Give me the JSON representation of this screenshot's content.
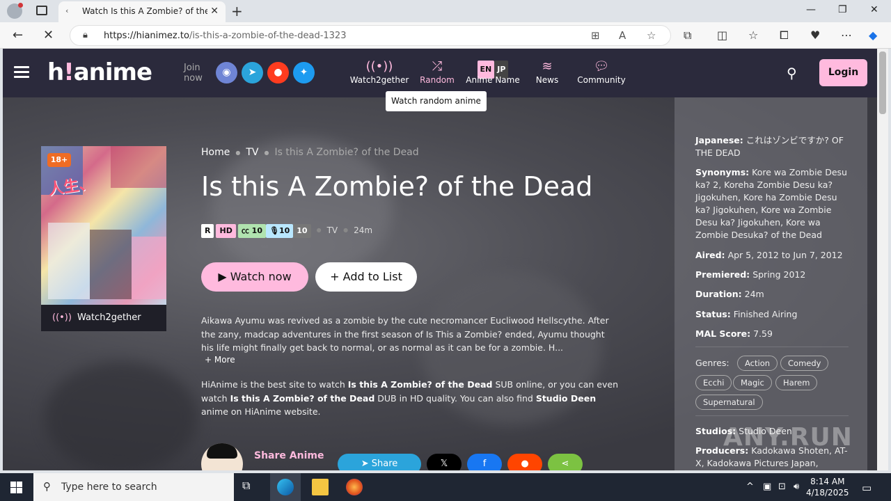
{
  "browser": {
    "tab_title": "Watch Is this A Zombie? of the Dead",
    "url_host": "https://hianimez.to",
    "url_path": "/is-this-a-zombie-of-the-dead-1323"
  },
  "site": {
    "logo_text_1": "h",
    "logo_bang": "!",
    "logo_text_2": "anime",
    "join_line1": "Join",
    "join_line2": "now",
    "nav": {
      "watch2gether": "Watch2gether",
      "random": "Random",
      "anime_name": "Anime Name",
      "lang_en": "EN",
      "lang_jp": "JP",
      "news": "News",
      "community": "Community"
    },
    "tooltip": "Watch random anime",
    "login": "Login",
    "accent": "#ffbade"
  },
  "anime": {
    "age_badge": "18+",
    "watch2gether": "Watch2gether",
    "breadcrumb": [
      "Home",
      "TV",
      "Is this A Zombie? of the Dead"
    ],
    "title": "Is this A Zombie? of the Dead",
    "badges": {
      "rating": "R",
      "quality": "HD",
      "sub": "10",
      "dub": "10",
      "eps": "10"
    },
    "type": "TV",
    "duration": "24m",
    "watch_now": "Watch now",
    "add_to_list": "Add to List",
    "description": "Aikawa Ayumu was revived as a zombie by the cute necromancer Eucliwood Hellscythe. After the zany, madcap adventures in the first season of Is This a Zombie? ended, Ayumu thought his life might finally get back to normal, or as normal as it can be for a zombie. H...",
    "more": "+ More",
    "seo_1": "HiAnime is the best site to watch ",
    "seo_title": "Is this A Zombie? of the Dead",
    "seo_2": " SUB online, or you can even watch ",
    "seo_3": " DUB in HD quality. You can also find ",
    "seo_studio": "Studio Deen",
    "seo_4": " anime on HiAnime website.",
    "share_label": "Share Anime",
    "share_telegram": "Share"
  },
  "info": {
    "japanese_label": "Japanese:",
    "japanese": "これはゾンビですか? OF THE DEAD",
    "synonyms_label": "Synonyms:",
    "synonyms": "Kore wa Zombie Desu ka? 2, Koreha Zombie Desu ka? Jigokuhen, Kore ha Zombie Desu ka? Jigokuhen, Kore wa Zombie Desu ka? Jigokuhen, Kore wa Zombie Desuka? of the Dead",
    "aired_label": "Aired:",
    "aired": "Apr 5, 2012 to Jun 7, 2012",
    "premiered_label": "Premiered:",
    "premiered": "Spring 2012",
    "duration_label": "Duration:",
    "duration": "24m",
    "status_label": "Status:",
    "status": "Finished Airing",
    "mal_label": "MAL Score:",
    "mal": "7.59",
    "genres_label": "Genres:",
    "genres": [
      "Action",
      "Comedy",
      "Ecchi",
      "Magic",
      "Harem",
      "Supernatural"
    ],
    "studios_label": "Studios:",
    "studios": "Studio Deen",
    "producers_label": "Producers:",
    "producers": "Kadokawa Shoten, AT-X, Kadokawa Pictures Japan,"
  },
  "watermark": "ANY.RUN",
  "taskbar": {
    "search_placeholder": "Type here to search",
    "time": "8:14 AM",
    "date": "4/18/2025"
  }
}
